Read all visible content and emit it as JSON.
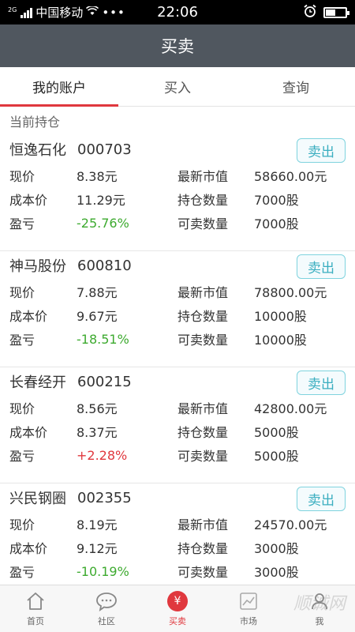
{
  "status": {
    "net_type": "2G",
    "carrier": "中国移动",
    "time": "22:06",
    "battery_fraction": 0.45
  },
  "header": {
    "title": "买卖"
  },
  "tabs": [
    {
      "label": "我的账户",
      "active": true
    },
    {
      "label": "买入",
      "active": false
    },
    {
      "label": "查询",
      "active": false
    }
  ],
  "section_label": "当前持仓",
  "labels": {
    "price": "现价",
    "cost": "成本价",
    "pnl": "盈亏",
    "market_value": "最新市值",
    "holding_qty": "持仓数量",
    "sellable_qty": "可卖数量",
    "sell_button": "卖出"
  },
  "holdings": [
    {
      "name": "恒逸石化",
      "code": "000703",
      "price": "8.38元",
      "cost": "11.29元",
      "pnl": "-25.76%",
      "market_value": "58660.00元",
      "holding_qty": "7000股",
      "sellable_qty": "7000股"
    },
    {
      "name": "神马股份",
      "code": "600810",
      "price": "7.88元",
      "cost": "9.67元",
      "pnl": "-18.51%",
      "market_value": "78800.00元",
      "holding_qty": "10000股",
      "sellable_qty": "10000股"
    },
    {
      "name": "长春经开",
      "code": "600215",
      "price": "8.56元",
      "cost": "8.37元",
      "pnl": "+2.28%",
      "market_value": "42800.00元",
      "holding_qty": "5000股",
      "sellable_qty": "5000股"
    },
    {
      "name": "兴民钢圈",
      "code": "002355",
      "price": "8.19元",
      "cost": "9.12元",
      "pnl": "-10.19%",
      "market_value": "24570.00元",
      "holding_qty": "3000股",
      "sellable_qty": "3000股"
    }
  ],
  "bottom_nav": [
    {
      "label": "首页",
      "icon": "home-icon",
      "active": false
    },
    {
      "label": "社区",
      "icon": "chat-bubble-icon",
      "active": false
    },
    {
      "label": "买卖",
      "icon": "yuan-icon",
      "active": true
    },
    {
      "label": "市场",
      "icon": "market-icon",
      "active": false
    },
    {
      "label": "我",
      "icon": "user-icon",
      "active": false
    }
  ],
  "watermark": "顺诚网",
  "colors": {
    "title_bg": "#50575f",
    "accent_red": "#e0383e",
    "loss_green": "#3daa2f",
    "sell_border": "#7fd3de"
  }
}
